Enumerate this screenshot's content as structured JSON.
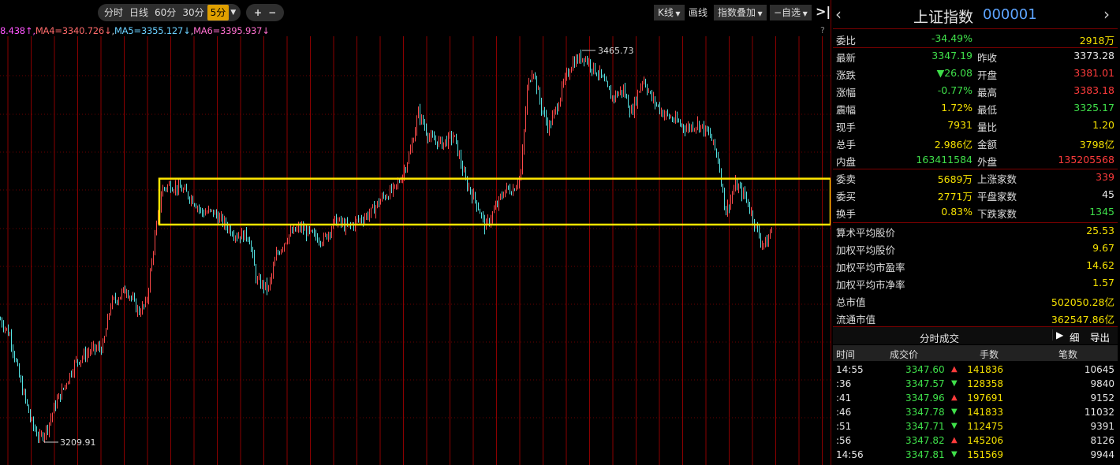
{
  "toolbar": {
    "period_tabs": [
      "分时",
      "日线",
      "60分",
      "30分",
      "5分"
    ],
    "active_tab": "5分",
    "zoom_in": "+",
    "zoom_out": "−",
    "kline_button": "K线",
    "draw_button": "画线",
    "overlay_button": "指数叠加",
    "watchlist_button": "−自选",
    "help": "?"
  },
  "ma_line": {
    "ma3": "8.438↑",
    "ma4": "MA4=3340.726↓",
    "ma5": "MA5=3355.127↓",
    "ma6": "MA6=3395.937↓"
  },
  "chart_data": {
    "type": "candlestick",
    "high_label": "3465.73",
    "low_label": "3209.91",
    "ylim": [
      3195,
      3475
    ],
    "highlight_box": {
      "from": 3352,
      "to": 3382
    },
    "anchors": [
      [
        0,
        3290
      ],
      [
        12,
        3280
      ],
      [
        25,
        3250
      ],
      [
        40,
        3222
      ],
      [
        50,
        3212
      ],
      [
        60,
        3220
      ],
      [
        70,
        3235
      ],
      [
        80,
        3245
      ],
      [
        95,
        3262
      ],
      [
        115,
        3270
      ],
      [
        130,
        3272
      ],
      [
        140,
        3300
      ],
      [
        150,
        3305
      ],
      [
        160,
        3310
      ],
      [
        175,
        3295
      ],
      [
        185,
        3300
      ],
      [
        195,
        3340
      ],
      [
        205,
        3375
      ],
      [
        215,
        3378
      ],
      [
        230,
        3375
      ],
      [
        245,
        3368
      ],
      [
        255,
        3360
      ],
      [
        270,
        3360
      ],
      [
        285,
        3352
      ],
      [
        300,
        3345
      ],
      [
        315,
        3345
      ],
      [
        325,
        3315
      ],
      [
        340,
        3310
      ],
      [
        350,
        3332
      ],
      [
        365,
        3345
      ],
      [
        380,
        3350
      ],
      [
        395,
        3345
      ],
      [
        410,
        3342
      ],
      [
        425,
        3355
      ],
      [
        440,
        3350
      ],
      [
        455,
        3355
      ],
      [
        470,
        3360
      ],
      [
        485,
        3370
      ],
      [
        500,
        3375
      ],
      [
        510,
        3385
      ],
      [
        520,
        3400
      ],
      [
        530,
        3425
      ],
      [
        545,
        3408
      ],
      [
        560,
        3405
      ],
      [
        575,
        3410
      ],
      [
        590,
        3380
      ],
      [
        605,
        3365
      ],
      [
        615,
        3350
      ],
      [
        625,
        3360
      ],
      [
        640,
        3375
      ],
      [
        650,
        3375
      ],
      [
        660,
        3385
      ],
      [
        668,
        3440
      ],
      [
        675,
        3455
      ],
      [
        685,
        3430
      ],
      [
        695,
        3415
      ],
      [
        705,
        3428
      ],
      [
        715,
        3445
      ],
      [
        725,
        3458
      ],
      [
        740,
        3462
      ],
      [
        750,
        3455
      ],
      [
        760,
        3450
      ],
      [
        775,
        3435
      ],
      [
        790,
        3440
      ],
      [
        800,
        3425
      ],
      [
        815,
        3448
      ],
      [
        825,
        3435
      ],
      [
        840,
        3425
      ],
      [
        855,
        3420
      ],
      [
        870,
        3415
      ],
      [
        885,
        3418
      ],
      [
        900,
        3410
      ],
      [
        910,
        3395
      ],
      [
        920,
        3360
      ],
      [
        932,
        3378
      ],
      [
        945,
        3370
      ],
      [
        955,
        3355
      ],
      [
        965,
        3340
      ],
      [
        972,
        3340
      ],
      [
        978,
        3350
      ]
    ]
  },
  "quote": {
    "title": "上证指数",
    "code": "000001",
    "weibi_label": "委比",
    "weibi_pct": "-34.49%",
    "weibi_vol": "2918万",
    "rows": [
      {
        "l1": "最新",
        "v1": "3347.19",
        "c1": "g",
        "l2": "昨收",
        "v2": "3373.28",
        "c2": "w"
      },
      {
        "l1": "涨跌",
        "v1": "▼26.08",
        "c1": "g",
        "l2": "开盘",
        "v2": "3381.01",
        "c2": "r"
      },
      {
        "l1": "涨幅",
        "v1": "-0.77%",
        "c1": "g",
        "l2": "最高",
        "v2": "3383.18",
        "c2": "r"
      },
      {
        "l1": "震幅",
        "v1": "1.72%",
        "c1": "y",
        "l2": "最低",
        "v2": "3325.17",
        "c2": "g"
      },
      {
        "l1": "现手",
        "v1": "7931",
        "c1": "y",
        "l2": "量比",
        "v2": "1.20",
        "c2": "y"
      },
      {
        "l1": "总手",
        "v1": "2.986亿",
        "c1": "y",
        "l2": "金额",
        "v2": "3798亿",
        "c2": "y"
      },
      {
        "l1": "内盘",
        "v1": "163411584",
        "c1": "g",
        "l2": "外盘",
        "v2": "135205568",
        "c2": "r"
      }
    ],
    "rows2": [
      {
        "l1": "委卖",
        "v1": "5689万",
        "c1": "y",
        "l2": "上涨家数",
        "v2": "339",
        "c2": "r"
      },
      {
        "l1": "委买",
        "v1": "2771万",
        "c1": "y",
        "l2": "平盘家数",
        "v2": "45",
        "c2": "w"
      },
      {
        "l1": "换手",
        "v1": "0.83%",
        "c1": "y",
        "l2": "下跌家数",
        "v2": "1345",
        "c2": "g"
      }
    ],
    "rows3": [
      {
        "l": "算术平均股价",
        "v": "25.53"
      },
      {
        "l": "加权平均股价",
        "v": "9.67"
      },
      {
        "l": "加权平均市盈率",
        "v": "14.62"
      },
      {
        "l": "加权平均市净率",
        "v": "1.57"
      },
      {
        "l": "总市值",
        "v": "502050.28亿"
      },
      {
        "l": "流通市值",
        "v": "362547.86亿"
      }
    ]
  },
  "ticks": {
    "title": "分时成交",
    "detail_button": "细",
    "export_button": "导出",
    "headers": [
      "时间",
      "成交价",
      "手数",
      "笔数"
    ],
    "rows": [
      {
        "t": "14:55",
        "p": "3347.60",
        "d": "▲",
        "v": "141836",
        "n": "10645"
      },
      {
        "t": ":36",
        "p": "3347.57",
        "d": "▼",
        "v": "128358",
        "n": "9840"
      },
      {
        "t": ":41",
        "p": "3347.96",
        "d": "▲",
        "v": "197691",
        "n": "9152"
      },
      {
        "t": ":46",
        "p": "3347.78",
        "d": "▼",
        "v": "141833",
        "n": "11032"
      },
      {
        "t": ":51",
        "p": "3347.71",
        "d": "▼",
        "v": "112475",
        "n": "9391"
      },
      {
        "t": ":56",
        "p": "3347.82",
        "d": "▲",
        "v": "145206",
        "n": "8126"
      },
      {
        "t": "14:56",
        "p": "3347.81",
        "d": "▼",
        "v": "151569",
        "n": "9944"
      }
    ]
  }
}
